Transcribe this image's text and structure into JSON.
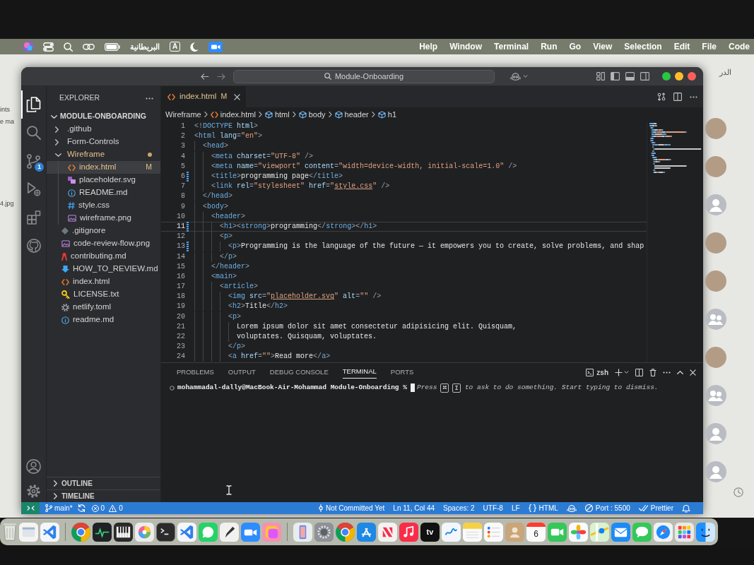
{
  "menu_bar": {
    "status_items": [
      {
        "kind": "siri"
      },
      {
        "kind": "control-center"
      },
      {
        "kind": "search"
      },
      {
        "kind": "screen-mirroring"
      },
      {
        "kind": "battery"
      },
      {
        "kind": "input-source",
        "text": "البريطانية"
      },
      {
        "kind": "keyboard",
        "text": "A"
      },
      {
        "kind": "focus"
      },
      {
        "kind": "zoom"
      }
    ],
    "menus": [
      "Help",
      "Window",
      "Terminal",
      "Run",
      "Go",
      "View",
      "Selection",
      "Edit",
      "File",
      "Code"
    ]
  },
  "background_window": {
    "texts": [
      "ints",
      "e ma",
      "4.jpg"
    ],
    "title": "الدر",
    "avatars": [
      {
        "kind": "photo"
      },
      {
        "kind": "photo"
      },
      {
        "kind": "person"
      },
      {
        "kind": "photo"
      },
      {
        "kind": "photo"
      },
      {
        "kind": "group"
      },
      {
        "kind": "photo"
      },
      {
        "kind": "group"
      },
      {
        "kind": "person"
      },
      {
        "kind": "person"
      }
    ]
  },
  "title_bar": {
    "search": "Module-Onboarding"
  },
  "activity_bar": {
    "items": [
      {
        "kind": "explorer",
        "selected": true
      },
      {
        "kind": "search",
        "selected": false
      },
      {
        "kind": "source-control",
        "selected": false,
        "badge": "1"
      },
      {
        "kind": "run",
        "selected": false
      },
      {
        "kind": "extensions",
        "selected": false
      },
      {
        "kind": "github",
        "selected": false
      }
    ],
    "bottom": [
      {
        "kind": "account"
      },
      {
        "kind": "settings"
      }
    ]
  },
  "explorer": {
    "title": "EXPLORER",
    "tree": {
      "label": "MODULE-ONBOARDING",
      "expanded": true,
      "children": [
        {
          "label": ".github",
          "kind": "folder",
          "expanded": false,
          "selected": false,
          "modified": false
        },
        {
          "label": "Form-Controls",
          "kind": "folder",
          "expanded": false,
          "selected": false,
          "modified": false
        },
        {
          "label": "Wireframe",
          "kind": "folder",
          "expanded": true,
          "selected": false,
          "modified": true,
          "children": [
            {
              "label": "index.html",
              "kind": "html",
              "selected": true,
              "modified": true,
              "badge": "M"
            },
            {
              "label": "placeholder.svg",
              "kind": "vector",
              "selected": false,
              "modified": false
            },
            {
              "label": "README.md",
              "kind": "readme",
              "selected": false,
              "modified": false
            },
            {
              "label": "style.css",
              "kind": "css",
              "selected": false,
              "modified": false
            },
            {
              "label": "wireframe.png",
              "kind": "image",
              "selected": false,
              "modified": false
            }
          ]
        },
        {
          "label": ".gitignore",
          "kind": "git",
          "selected": false,
          "modified": false
        },
        {
          "label": "code-review-flow.png",
          "kind": "image",
          "selected": false,
          "modified": false
        },
        {
          "label": "contributing.md",
          "kind": "contributing",
          "selected": false,
          "modified": false
        },
        {
          "label": "HOW_TO_REVIEW.md",
          "kind": "markdown",
          "selected": false,
          "modified": false
        },
        {
          "label": "index.html",
          "kind": "html",
          "selected": false,
          "modified": false
        },
        {
          "label": "LICENSE.txt",
          "kind": "license",
          "selected": false,
          "modified": false
        },
        {
          "label": "netlify.toml",
          "kind": "config",
          "selected": false,
          "modified": false
        },
        {
          "label": "readme.md",
          "kind": "readme",
          "selected": false,
          "modified": false
        }
      ]
    },
    "sections": [
      {
        "label": "OUTLINE",
        "expanded": false
      },
      {
        "label": "TIMELINE",
        "expanded": false
      }
    ]
  },
  "editor": {
    "tabs": [
      {
        "label": "index.html",
        "badge": "M",
        "modified": true,
        "selected": true
      }
    ],
    "breadcrumb": [
      {
        "kind": "folder",
        "label": "Wireframe"
      },
      {
        "kind": "html",
        "label": "index.html"
      },
      {
        "kind": "element",
        "label": "html"
      },
      {
        "kind": "element",
        "label": "body"
      },
      {
        "kind": "element",
        "label": "header"
      },
      {
        "kind": "element",
        "label": "h1"
      }
    ],
    "lines": [
      {
        "number": "1",
        "modified": false,
        "current": false,
        "code": [
          {
            "kind": "punct",
            "text": "<!"
          },
          {
            "kind": "tag",
            "text": "DOCTYPE"
          },
          {
            "kind": "attr",
            "text": " html"
          },
          {
            "kind": "punct",
            "text": ">"
          }
        ]
      },
      {
        "number": "2",
        "modified": false,
        "current": false,
        "code": [
          {
            "kind": "punct",
            "text": "<"
          },
          {
            "kind": "tag",
            "text": "html"
          },
          {
            "kind": "attr",
            "text": " lang"
          },
          {
            "kind": "punct",
            "text": "="
          },
          {
            "kind": "string",
            "text": "\"en\""
          },
          {
            "kind": "punct",
            "text": ">"
          }
        ],
        "children": [
          {
            "number": "3",
            "modified": false,
            "current": false,
            "code": [
              {
                "kind": "punct",
                "text": "<"
              },
              {
                "kind": "tag",
                "text": "head"
              },
              {
                "kind": "punct",
                "text": ">"
              }
            ],
            "children": [
              {
                "number": "4",
                "modified": false,
                "current": false,
                "code": [
                  {
                    "kind": "punct",
                    "text": "<"
                  },
                  {
                    "kind": "tag",
                    "text": "meta"
                  },
                  {
                    "kind": "attr",
                    "text": " charset"
                  },
                  {
                    "kind": "punct",
                    "text": "="
                  },
                  {
                    "kind": "string",
                    "text": "\"UTF-8\""
                  },
                  {
                    "kind": "punct",
                    "text": " />"
                  }
                ]
              },
              {
                "number": "5",
                "modified": false,
                "current": false,
                "code": [
                  {
                    "kind": "punct",
                    "text": "<"
                  },
                  {
                    "kind": "tag",
                    "text": "meta"
                  },
                  {
                    "kind": "attr",
                    "text": " name"
                  },
                  {
                    "kind": "punct",
                    "text": "="
                  },
                  {
                    "kind": "string",
                    "text": "\"viewport\""
                  },
                  {
                    "kind": "attr",
                    "text": " content"
                  },
                  {
                    "kind": "punct",
                    "text": "="
                  },
                  {
                    "kind": "string",
                    "text": "\"width=device-width, initial-scale=1.0\""
                  },
                  {
                    "kind": "punct",
                    "text": " />"
                  }
                ]
              },
              {
                "number": "6",
                "modified": true,
                "current": false,
                "code": [
                  {
                    "kind": "punct",
                    "text": "<"
                  },
                  {
                    "kind": "tag",
                    "text": "title"
                  },
                  {
                    "kind": "punct",
                    "text": ">"
                  },
                  {
                    "kind": "text",
                    "text": "programming page"
                  },
                  {
                    "kind": "punct",
                    "text": "</"
                  },
                  {
                    "kind": "tag",
                    "text": "title"
                  },
                  {
                    "kind": "punct",
                    "text": ">"
                  }
                ]
              },
              {
                "number": "7",
                "modified": false,
                "current": false,
                "code": [
                  {
                    "kind": "punct",
                    "text": "<"
                  },
                  {
                    "kind": "tag",
                    "text": "link"
                  },
                  {
                    "kind": "attr",
                    "text": " rel"
                  },
                  {
                    "kind": "punct",
                    "text": "="
                  },
                  {
                    "kind": "string",
                    "text": "\"stylesheet\""
                  },
                  {
                    "kind": "attr",
                    "text": " href"
                  },
                  {
                    "kind": "punct",
                    "text": "="
                  },
                  {
                    "kind": "string",
                    "text": "\""
                  },
                  {
                    "kind": "link",
                    "text": "style.css"
                  },
                  {
                    "kind": "string",
                    "text": "\""
                  },
                  {
                    "kind": "punct",
                    "text": " />"
                  }
                ]
              }
            ]
          },
          {
            "number": "8",
            "modified": false,
            "current": false,
            "code": [
              {
                "kind": "punct",
                "text": "</"
              },
              {
                "kind": "tag",
                "text": "head"
              },
              {
                "kind": "punct",
                "text": ">"
              }
            ]
          },
          {
            "number": "9",
            "modified": false,
            "current": false,
            "code": [
              {
                "kind": "punct",
                "text": "<"
              },
              {
                "kind": "tag",
                "text": "body"
              },
              {
                "kind": "punct",
                "text": ">"
              }
            ],
            "children": [
              {
                "number": "10",
                "modified": false,
                "current": false,
                "code": [
                  {
                    "kind": "punct",
                    "text": "<"
                  },
                  {
                    "kind": "tag",
                    "text": "header"
                  },
                  {
                    "kind": "punct",
                    "text": ">"
                  }
                ],
                "children": [
                  {
                    "number": "11",
                    "modified": true,
                    "current": true,
                    "code": [
                      {
                        "kind": "punct",
                        "text": "<"
                      },
                      {
                        "kind": "tag",
                        "text": "h1"
                      },
                      {
                        "kind": "punct",
                        "text": ">"
                      },
                      {
                        "kind": "punct",
                        "text": "<"
                      },
                      {
                        "kind": "tag",
                        "text": "strong"
                      },
                      {
                        "kind": "punct",
                        "text": ">"
                      },
                      {
                        "kind": "text",
                        "text": "programming"
                      },
                      {
                        "kind": "punct",
                        "text": "</"
                      },
                      {
                        "kind": "tag",
                        "text": "strong"
                      },
                      {
                        "kind": "punct",
                        "text": ">"
                      },
                      {
                        "kind": "punct",
                        "text": "</"
                      },
                      {
                        "kind": "tag",
                        "text": "h1"
                      },
                      {
                        "kind": "punct",
                        "text": ">"
                      }
                    ]
                  },
                  {
                    "number": "12",
                    "modified": false,
                    "current": false,
                    "code": [
                      {
                        "kind": "punct",
                        "text": "<"
                      },
                      {
                        "kind": "tag",
                        "text": "p"
                      },
                      {
                        "kind": "punct",
                        "text": ">"
                      }
                    ],
                    "children": [
                      {
                        "number": "13",
                        "modified": true,
                        "current": false,
                        "code": [
                          {
                            "kind": "punct",
                            "text": "<"
                          },
                          {
                            "kind": "tag",
                            "text": "p"
                          },
                          {
                            "kind": "punct",
                            "text": ">"
                          },
                          {
                            "kind": "text",
                            "text": "Programming is the language of the future — it empowers you to create, solve problems, and shap"
                          }
                        ]
                      }
                    ]
                  },
                  {
                    "number": "14",
                    "modified": false,
                    "current": false,
                    "code": [
                      {
                        "kind": "punct",
                        "text": "</"
                      },
                      {
                        "kind": "tag",
                        "text": "p"
                      },
                      {
                        "kind": "punct",
                        "text": ">"
                      }
                    ]
                  }
                ]
              },
              {
                "number": "15",
                "modified": false,
                "current": false,
                "code": [
                  {
                    "kind": "punct",
                    "text": "</"
                  },
                  {
                    "kind": "tag",
                    "text": "header"
                  },
                  {
                    "kind": "punct",
                    "text": ">"
                  }
                ]
              },
              {
                "number": "16",
                "modified": false,
                "current": false,
                "code": [
                  {
                    "kind": "punct",
                    "text": "<"
                  },
                  {
                    "kind": "tag",
                    "text": "main"
                  },
                  {
                    "kind": "punct",
                    "text": ">"
                  }
                ],
                "children": [
                  {
                    "number": "17",
                    "modified": false,
                    "current": false,
                    "code": [
                      {
                        "kind": "punct",
                        "text": "<"
                      },
                      {
                        "kind": "tag",
                        "text": "article"
                      },
                      {
                        "kind": "punct",
                        "text": ">"
                      }
                    ],
                    "children": [
                      {
                        "number": "18",
                        "modified": false,
                        "current": false,
                        "code": [
                          {
                            "kind": "punct",
                            "text": "<"
                          },
                          {
                            "kind": "tag",
                            "text": "img"
                          },
                          {
                            "kind": "attr",
                            "text": " src"
                          },
                          {
                            "kind": "punct",
                            "text": "="
                          },
                          {
                            "kind": "string",
                            "text": "\""
                          },
                          {
                            "kind": "link",
                            "text": "placeholder.svg"
                          },
                          {
                            "kind": "string",
                            "text": "\""
                          },
                          {
                            "kind": "attr",
                            "text": " alt"
                          },
                          {
                            "kind": "punct",
                            "text": "="
                          },
                          {
                            "kind": "string",
                            "text": "\"\""
                          },
                          {
                            "kind": "punct",
                            "text": " />"
                          }
                        ]
                      },
                      {
                        "number": "19",
                        "modified": false,
                        "current": false,
                        "code": [
                          {
                            "kind": "punct",
                            "text": "<"
                          },
                          {
                            "kind": "tag",
                            "text": "h2"
                          },
                          {
                            "kind": "punct",
                            "text": ">"
                          },
                          {
                            "kind": "text",
                            "text": "Title"
                          },
                          {
                            "kind": "punct",
                            "text": "</"
                          },
                          {
                            "kind": "tag",
                            "text": "h2"
                          },
                          {
                            "kind": "punct",
                            "text": ">"
                          }
                        ]
                      },
                      {
                        "number": "20",
                        "modified": false,
                        "current": false,
                        "code": [
                          {
                            "kind": "punct",
                            "text": "<"
                          },
                          {
                            "kind": "tag",
                            "text": "p"
                          },
                          {
                            "kind": "punct",
                            "text": ">"
                          }
                        ],
                        "children": [
                          {
                            "number": "21",
                            "modified": false,
                            "current": false,
                            "code": [
                              {
                                "kind": "text",
                                "text": "Lorem ipsum dolor sit amet consectetur adipisicing elit. Quisquam,"
                              }
                            ]
                          },
                          {
                            "number": "22",
                            "modified": false,
                            "current": false,
                            "code": [
                              {
                                "kind": "text",
                                "text": "voluptates. Quisquam, voluptates."
                              }
                            ]
                          }
                        ]
                      },
                      {
                        "number": "23",
                        "modified": false,
                        "current": false,
                        "code": [
                          {
                            "kind": "punct",
                            "text": "</"
                          },
                          {
                            "kind": "tag",
                            "text": "p"
                          },
                          {
                            "kind": "punct",
                            "text": ">"
                          }
                        ]
                      },
                      {
                        "number": "24",
                        "modified": false,
                        "current": false,
                        "code": [
                          {
                            "kind": "punct",
                            "text": "<"
                          },
                          {
                            "kind": "tag",
                            "text": "a"
                          },
                          {
                            "kind": "attr",
                            "text": " href"
                          },
                          {
                            "kind": "punct",
                            "text": "="
                          },
                          {
                            "kind": "string",
                            "text": "\"\""
                          },
                          {
                            "kind": "punct",
                            "text": ">"
                          },
                          {
                            "kind": "text",
                            "text": "Read more"
                          },
                          {
                            "kind": "punct",
                            "text": "</"
                          },
                          {
                            "kind": "tag",
                            "text": "a"
                          },
                          {
                            "kind": "punct",
                            "text": ">"
                          }
                        ]
                      }
                    ]
                  }
                ]
              }
            ]
          }
        ]
      }
    ]
  },
  "panel": {
    "tabs": [
      {
        "label": "PROBLEMS",
        "selected": false
      },
      {
        "label": "OUTPUT",
        "selected": false
      },
      {
        "label": "DEBUG CONSOLE",
        "selected": false
      },
      {
        "label": "TERMINAL",
        "selected": true
      },
      {
        "label": "PORTS",
        "selected": false
      }
    ],
    "shell": "zsh",
    "terminal": {
      "prompt": "mohammadal-dally@MacBook-Air-Mohammad Module-Onboarding %",
      "hint_before": "Press",
      "keys": [
        "⌘",
        "I"
      ],
      "hint_after": "to ask to do something. Start typing to dismiss."
    }
  },
  "status_bar": {
    "branch": "main*",
    "errors": "0",
    "warnings": "0",
    "items": [
      {
        "kind": "blame",
        "text": "Not Committed Yet"
      },
      {
        "kind": "position",
        "text": "Ln 11, Col 44"
      },
      {
        "kind": "indent",
        "text": "Spaces: 2"
      },
      {
        "kind": "encoding",
        "text": "UTF-8"
      },
      {
        "kind": "eol",
        "text": "LF"
      },
      {
        "kind": "language",
        "text": "HTML"
      },
      {
        "kind": "copilot"
      },
      {
        "kind": "port",
        "text": "Port : 5500"
      },
      {
        "kind": "formatter",
        "text": "Prettier"
      },
      {
        "kind": "notifications"
      }
    ]
  },
  "dock": [
    {
      "kind": "trash"
    },
    {
      "kind": "window"
    },
    {
      "kind": "vscode"
    },
    {
      "kind": "separator"
    },
    {
      "kind": "chrome"
    },
    {
      "kind": "activity"
    },
    {
      "kind": "piano"
    },
    {
      "kind": "colorwheel"
    },
    {
      "kind": "terminal"
    },
    {
      "kind": "vscode"
    },
    {
      "kind": "whatsapp"
    },
    {
      "kind": "pencil"
    },
    {
      "kind": "zoom"
    },
    {
      "kind": "gradient"
    },
    {
      "kind": "separator"
    },
    {
      "kind": "iphone"
    },
    {
      "kind": "settings"
    },
    {
      "kind": "chrome"
    },
    {
      "kind": "appstore"
    },
    {
      "kind": "news"
    },
    {
      "kind": "music"
    },
    {
      "kind": "tv",
      "text": "tv"
    },
    {
      "kind": "freeform"
    },
    {
      "kind": "notes"
    },
    {
      "kind": "reminders"
    },
    {
      "kind": "contacts"
    },
    {
      "kind": "calendar",
      "text": "6"
    },
    {
      "kind": "facetime"
    },
    {
      "kind": "photos"
    },
    {
      "kind": "maps"
    },
    {
      "kind": "mail"
    },
    {
      "kind": "messages"
    },
    {
      "kind": "safari"
    },
    {
      "kind": "launchpad"
    },
    {
      "kind": "finder"
    }
  ]
}
